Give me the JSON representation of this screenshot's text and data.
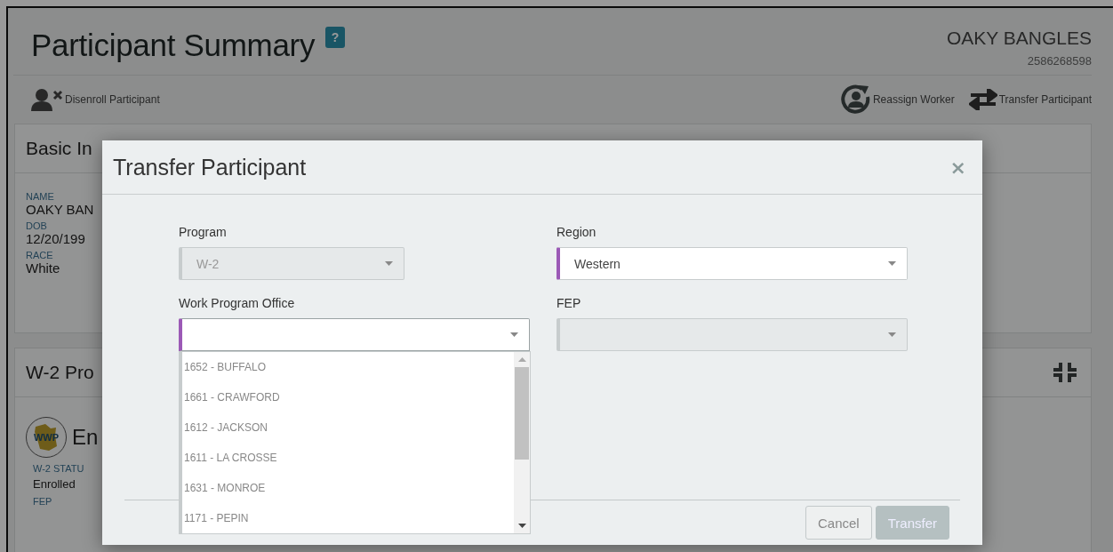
{
  "page": {
    "title": "Participant Summary",
    "help_badge": "?",
    "participant_name": "OAKY BANGLES",
    "participant_id": "2586268598",
    "actions": [
      {
        "kind": "disenroll",
        "label": "Disenroll Participant"
      },
      {
        "kind": "reassign",
        "label": "Reassign Worker"
      },
      {
        "kind": "transfer",
        "label": "Transfer Participant"
      }
    ],
    "basic_info": {
      "title": "Basic In",
      "fields": [
        {
          "label": "NAME",
          "value": "OAKY BAN"
        },
        {
          "label": "DOB",
          "value": "12/20/199"
        },
        {
          "label": "RACE",
          "value": "White"
        }
      ]
    },
    "program_card": {
      "title": "W-2 Pro",
      "logo_text": "WWP",
      "heading": "En",
      "fields": [
        {
          "label": "W-2 STATU",
          "value": "Enrolled"
        },
        {
          "label": "FEP"
        }
      ]
    }
  },
  "dialog": {
    "title": "Transfer Participant",
    "close": "×",
    "fields": [
      {
        "label": "Program",
        "value": "W-2",
        "disabled": true,
        "required": false
      },
      {
        "label": "Region",
        "value": "Western",
        "disabled": false,
        "required": true
      },
      {
        "label": "Work Program Office",
        "disabled": false,
        "required": true,
        "expanded": true,
        "options": [
          "1652 - BUFFALO",
          "1661 - CRAWFORD",
          "1612 - JACKSON",
          "1611 - LA CROSSE",
          "1631 - MONROE",
          "1171 - PEPIN"
        ]
      },
      {
        "label": "FEP",
        "disabled": true,
        "required": false
      }
    ],
    "buttons": [
      {
        "label": "Cancel",
        "kind": "secondary",
        "disabled": false
      },
      {
        "label": "Transfer",
        "kind": "primary",
        "disabled": true
      }
    ]
  }
}
